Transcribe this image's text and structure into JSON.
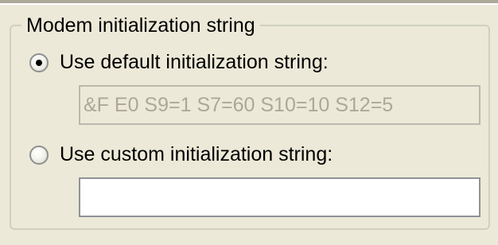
{
  "group": {
    "title": "Modem initialization string"
  },
  "options": {
    "default": {
      "label": "Use default initialization string:",
      "checked": true,
      "value": "&F E0 S9=1 S7=60 S10=10 S12=5"
    },
    "custom": {
      "label": "Use custom initialization string:",
      "checked": false,
      "value": ""
    }
  },
  "colors": {
    "background": "#ece9d8",
    "group_border": "#d0d0bf",
    "disabled_text": "#aca899"
  }
}
